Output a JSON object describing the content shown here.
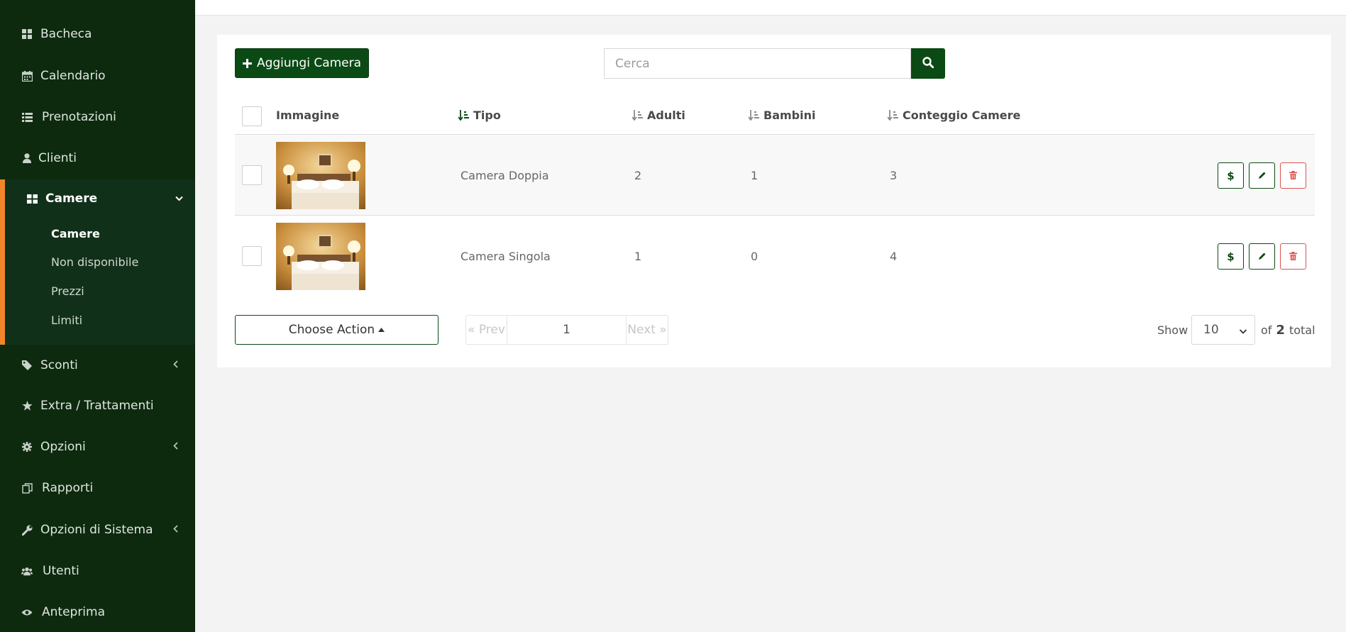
{
  "sidebar": {
    "items": [
      {
        "label": "Bacheca",
        "icon": "dashboard-icon"
      },
      {
        "label": "Calendario",
        "icon": "calendar-icon"
      },
      {
        "label": "Prenotazioni",
        "icon": "list-icon"
      },
      {
        "label": "Clienti",
        "icon": "user-icon"
      },
      {
        "label": "Camere",
        "icon": "grid-icon",
        "expanded": true
      },
      {
        "label": "Sconti",
        "icon": "tag-icon"
      },
      {
        "label": "Extra / Trattamenti",
        "icon": "star-icon"
      },
      {
        "label": "Opzioni",
        "icon": "gear-icon"
      },
      {
        "label": "Rapporti",
        "icon": "report-icon"
      },
      {
        "label": "Opzioni di Sistema",
        "icon": "wrench-icon"
      },
      {
        "label": "Utenti",
        "icon": "users-icon"
      },
      {
        "label": "Anteprima",
        "icon": "eye-icon"
      }
    ],
    "submenu": [
      {
        "label": "Camere",
        "active": true
      },
      {
        "label": "Non disponibile"
      },
      {
        "label": "Prezzi"
      },
      {
        "label": "Limiti"
      }
    ]
  },
  "toolbar": {
    "add_label": "Aggiungi Camera",
    "search_placeholder": "Cerca"
  },
  "table": {
    "headers": {
      "image": "Immagine",
      "type": "Tipo",
      "adults": "Adulti",
      "children": "Bambini",
      "count": "Conteggio Camere"
    },
    "rows": [
      {
        "type": "Camera Doppia",
        "adults": "2",
        "children": "1",
        "count": "3"
      },
      {
        "type": "Camera Singola",
        "adults": "1",
        "children": "0",
        "count": "4"
      }
    ]
  },
  "footer": {
    "choose_action": "Choose Action",
    "prev": "« Prev",
    "page": "1",
    "next": "Next »",
    "show": "Show",
    "per_page": "10",
    "of": "of",
    "total_count": "2",
    "total": "total"
  },
  "colors": {
    "sidebar_bg": "#0d2a0f",
    "primary": "#0b4a14",
    "accent": "#f2852a",
    "danger": "#d9534f"
  }
}
